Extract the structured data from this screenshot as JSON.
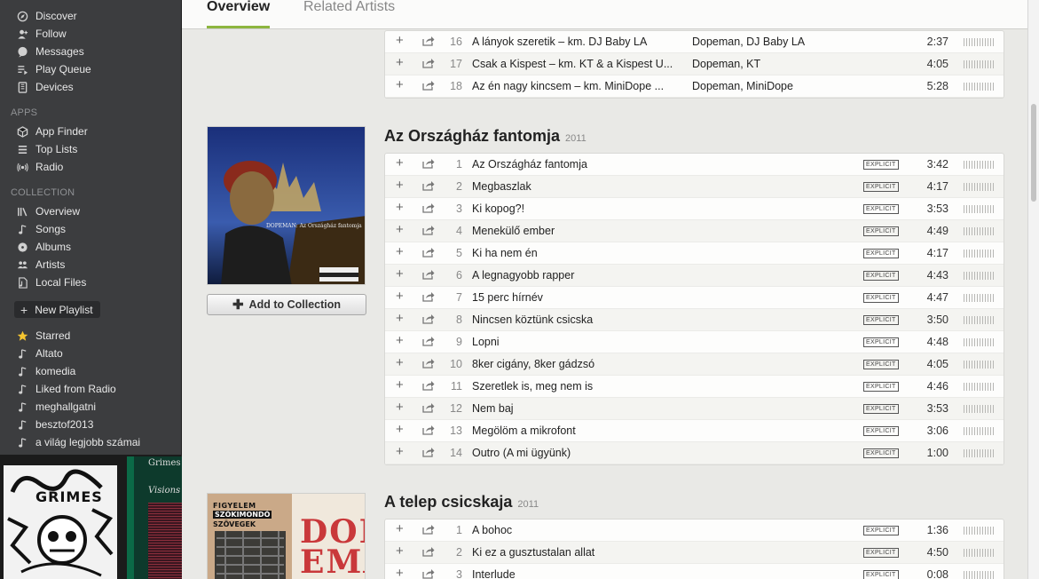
{
  "sidebar": {
    "main_items": [
      {
        "label": "Discover",
        "icon": "discover-icon"
      },
      {
        "label": "Follow",
        "icon": "follow-icon"
      },
      {
        "label": "Messages",
        "icon": "messages-icon"
      },
      {
        "label": "Play Queue",
        "icon": "play-queue-icon"
      },
      {
        "label": "Devices",
        "icon": "devices-icon"
      }
    ],
    "apps_header": "APPS",
    "apps_items": [
      {
        "label": "App Finder",
        "icon": "app-finder-icon"
      },
      {
        "label": "Top Lists",
        "icon": "top-lists-icon"
      },
      {
        "label": "Radio",
        "icon": "radio-icon"
      }
    ],
    "collection_header": "COLLECTION",
    "collection_items": [
      {
        "label": "Overview",
        "icon": "overview-icon"
      },
      {
        "label": "Songs",
        "icon": "note-icon"
      },
      {
        "label": "Albums",
        "icon": "albums-icon"
      },
      {
        "label": "Artists",
        "icon": "artists-icon"
      },
      {
        "label": "Local Files",
        "icon": "local-files-icon"
      }
    ],
    "new_playlist": "New Playlist",
    "playlists": [
      {
        "label": "Starred",
        "icon": "star-icon"
      },
      {
        "label": "Altato",
        "icon": "note-icon"
      },
      {
        "label": "komedia",
        "icon": "note-icon"
      },
      {
        "label": "Liked from Radio",
        "icon": "note-icon"
      },
      {
        "label": "meghallgatni",
        "icon": "note-icon"
      },
      {
        "label": "besztof2013",
        "icon": "note-icon"
      },
      {
        "label": "a világ legjobb számai",
        "icon": "note-icon"
      }
    ],
    "art": {
      "grimes_text": "GRIMES",
      "visions_artist": "Grimes",
      "visions_title": "Visions"
    }
  },
  "tabs": {
    "overview": "Overview",
    "related": "Related Artists"
  },
  "explicit_label": "EXPLICIT",
  "top_tracks": [
    {
      "num": "16",
      "title": "A lányok szeretik – km. DJ Baby LA",
      "artist": "Dopeman, DJ Baby LA",
      "duration": "2:37"
    },
    {
      "num": "17",
      "title": "Csak a Kispest – km. KT & a Kispest U...",
      "artist": "Dopeman, KT",
      "duration": "4:05"
    },
    {
      "num": "18",
      "title": "Az én nagy kincsem – km. MiniDope ...",
      "artist": "Dopeman, MiniDope",
      "duration": "5:28"
    }
  ],
  "album1": {
    "title": "Az Országház fantomja",
    "year": "2011",
    "cover_text": "DOPEMAN: Az Országház fantomja",
    "cover_badge": "FIGYELEM SZÓKIMONDÓ SZÖVEGEK",
    "add_button": "Add to Collection",
    "tracks": [
      {
        "num": "1",
        "title": "Az Országház fantomja",
        "duration": "3:42"
      },
      {
        "num": "2",
        "title": "Megbaszlak",
        "duration": "4:17"
      },
      {
        "num": "3",
        "title": "Ki kopog?!",
        "duration": "3:53"
      },
      {
        "num": "4",
        "title": "Menekülő ember",
        "duration": "4:49"
      },
      {
        "num": "5",
        "title": "Ki ha nem én",
        "duration": "4:17"
      },
      {
        "num": "6",
        "title": "A legnagyobb rapper",
        "duration": "4:43"
      },
      {
        "num": "7",
        "title": "15 perc hírnév",
        "duration": "4:47"
      },
      {
        "num": "8",
        "title": "Nincsen köztünk csicska",
        "duration": "3:50"
      },
      {
        "num": "9",
        "title": "Lopni",
        "duration": "4:48"
      },
      {
        "num": "10",
        "title": "8ker cigány, 8ker gádzsó",
        "duration": "4:05"
      },
      {
        "num": "11",
        "title": "Szeretlek is, meg nem is",
        "duration": "4:46"
      },
      {
        "num": "12",
        "title": "Nem baj",
        "duration": "3:53"
      },
      {
        "num": "13",
        "title": "Megölöm a mikrofont",
        "duration": "3:06"
      },
      {
        "num": "14",
        "title": "Outro (A mi ügyünk)",
        "duration": "1:00"
      }
    ]
  },
  "album2": {
    "title": "A telep csicskaja",
    "year": "2011",
    "cover_badge_1": "FIGYELEM",
    "cover_badge_2": "SZÓKIMONDÓ",
    "cover_badge_3": "SZÖVEGEK",
    "cover_text": "DOP EMA",
    "tracks": [
      {
        "num": "1",
        "title": "A bohoc",
        "duration": "1:36"
      },
      {
        "num": "2",
        "title": "Ki ez a gusztustalan allat",
        "duration": "4:50"
      },
      {
        "num": "3",
        "title": "Interlude",
        "duration": "0:08"
      }
    ]
  },
  "colors": {
    "accent": "#8db63f",
    "sidebar_bg": "#3c3d3f",
    "star": "#f4c430"
  }
}
